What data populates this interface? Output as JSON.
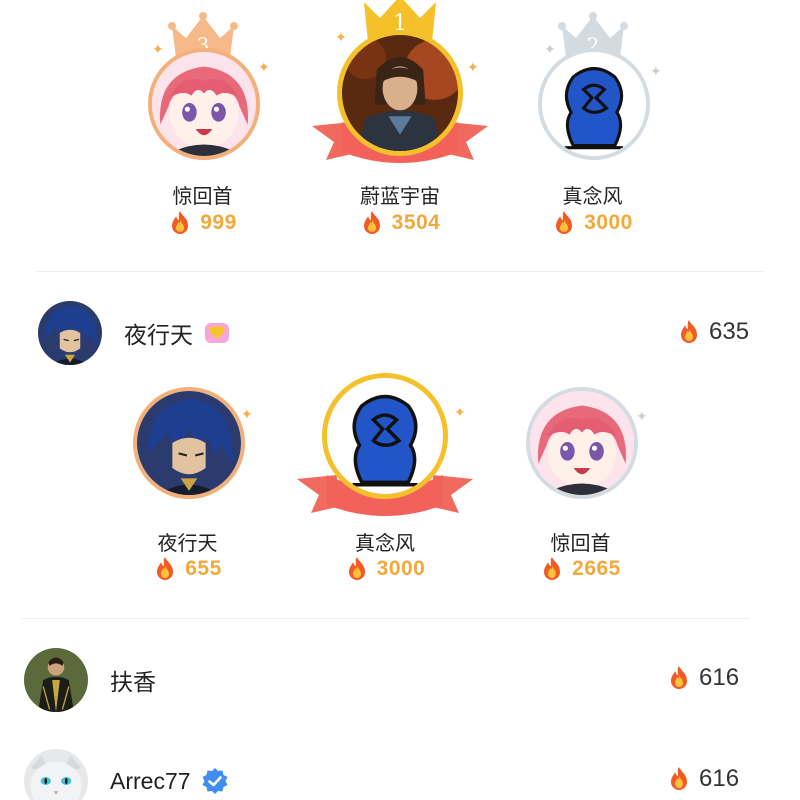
{
  "podium_top": {
    "left": {
      "rank": "3",
      "name": "惊回首",
      "score": "999",
      "avatar": "anime-girl-pink-hair"
    },
    "center": {
      "rank": "1",
      "name": "蔚蓝宇宙",
      "score": "3504",
      "avatar": "armored-man"
    },
    "right": {
      "rank": "2",
      "name": "真念风",
      "score": "3000",
      "avatar": "blue-silhouette"
    }
  },
  "row_1": {
    "name": "夜行天",
    "score": "635",
    "avatar": "anime-blue-hair-man",
    "badge": "pink-heart-badge"
  },
  "podium_bottom": {
    "left": {
      "name": "夜行天",
      "score": "655",
      "avatar": "anime-blue-hair-man"
    },
    "center": {
      "name": "真念风",
      "score": "3000",
      "avatar": "blue-silhouette"
    },
    "right": {
      "name": "惊回首",
      "score": "2665",
      "avatar": "anime-girl-pink-hair"
    }
  },
  "list": [
    {
      "name": "扶香",
      "score": "616",
      "avatar": "dark-robed-figure"
    },
    {
      "name": "Arrec77",
      "score": "616",
      "avatar": "white-cat",
      "badge": "verified-badge"
    }
  ],
  "colors": {
    "gold": "#f5c02a",
    "bronze": "#f3b07a",
    "silver": "#c9d3d9",
    "ribbon": "#f2625b",
    "score": "#f2a93b"
  }
}
